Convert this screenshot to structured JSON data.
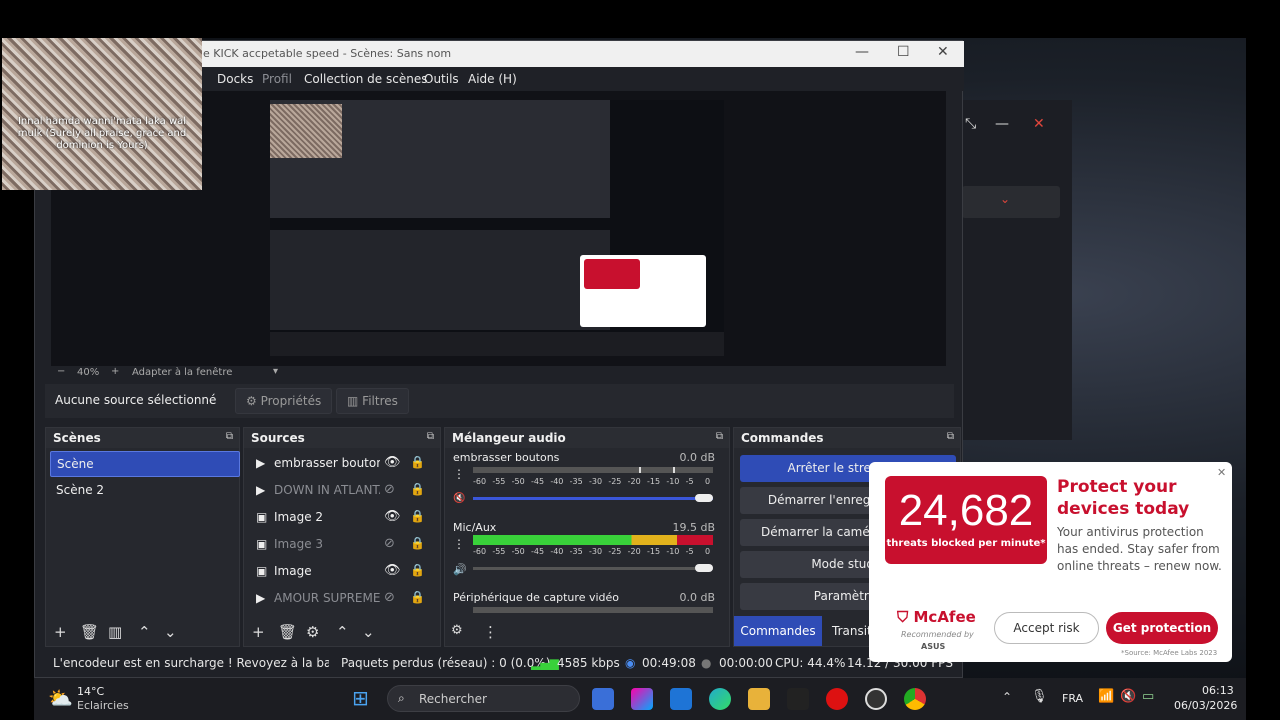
{
  "window": {
    "title": "e KICK accpetable speed - Scènes: Sans nom",
    "menu": [
      "Docks",
      "Profil",
      "Collection de scènes",
      "Outils",
      "Aide (H)"
    ]
  },
  "preview_bar": {
    "zoom": "40%",
    "fit": "Adapter à la fenêtre"
  },
  "properties_bar": {
    "no_source": "Aucune source sélectionné",
    "properties_label": "Propriétés",
    "filters_label": "Filtres"
  },
  "scenes": {
    "title": "Scènes",
    "items": [
      "Scène",
      "Scène 2"
    ]
  },
  "sources": {
    "title": "Sources",
    "items": [
      {
        "label": "embrasser boutons",
        "visible": true,
        "icon": "play-icon"
      },
      {
        "label": "DOWN IN ATLANTA",
        "visible": false,
        "icon": "play-icon"
      },
      {
        "label": "Image 2",
        "visible": true,
        "icon": "image-icon"
      },
      {
        "label": "Image 3",
        "visible": false,
        "icon": "image-icon"
      },
      {
        "label": "Image",
        "visible": true,
        "icon": "image-icon"
      },
      {
        "label": "AMOUR SUPREME",
        "visible": false,
        "icon": "play-icon"
      }
    ]
  },
  "mixer": {
    "title": "Mélangeur audio",
    "scale": [
      "-60",
      "-55",
      "-50",
      "-45",
      "-40",
      "-35",
      "-30",
      "-25",
      "-20",
      "-15",
      "-10",
      "-5",
      "0"
    ],
    "channels": [
      {
        "name": "embrasser boutons",
        "db": "0.0 dB"
      },
      {
        "name": "Mic/Aux",
        "db": "19.5 dB"
      },
      {
        "name": "Périphérique de capture vidéo",
        "db": "0.0 dB"
      }
    ]
  },
  "commands": {
    "title": "Commandes",
    "buttons": [
      "Arrêter le streaming",
      "Démarrer l'enregistrement",
      "Démarrer la caméra virtuelle",
      "Mode studio",
      "Paramètres"
    ],
    "tabs": [
      "Commandes",
      "Transitions"
    ]
  },
  "status": {
    "warning": "L'encodeur est en surcharge ! Revoyez à la baisse vos",
    "dropped": "Paquets perdus (réseau) : 0 (0.0%)",
    "bitrate": "4585 kbps",
    "stream_time": "00:49:08",
    "rec_time": "00:00:00",
    "cpu": "CPU: 44.4%",
    "fps": "14.12 / 30.00 FPS"
  },
  "overlay": {
    "caption": "Innal hamda wanni'mata laka wal mulk (Surely all praise, grace and dominion is Yours)"
  },
  "mcafee": {
    "count": "24,682",
    "threats": "threats blocked per minute*",
    "headline": "Protect your devices today",
    "body": "Your antivirus protection has ended. Stay safer from online threats – renew now.",
    "brand": "McAfee",
    "recommended": "Recommended by",
    "partner": "ASUS",
    "accept": "Accept risk",
    "get": "Get protection",
    "source": "*Source: McAfee Labs 2023"
  },
  "taskbar": {
    "temp": "14°C",
    "weather": "Eclaircies",
    "search_placeholder": "Rechercher",
    "lang": "FRA",
    "time": "06:13",
    "date": "06/03/2026"
  }
}
